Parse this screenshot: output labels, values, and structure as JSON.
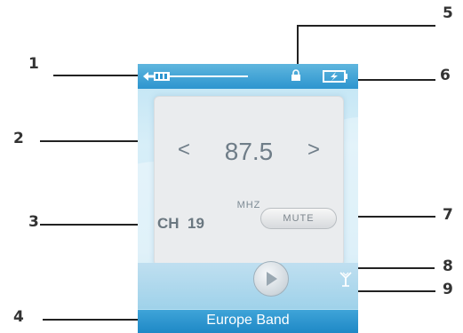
{
  "callouts": [
    "1",
    "2",
    "3",
    "4",
    "5",
    "6",
    "7",
    "8",
    "9"
  ],
  "tuner": {
    "prev_label": "<",
    "next_label": ">",
    "frequency": "87.5",
    "unit": "MHZ",
    "channel": "CH  19",
    "mute_label": "MUTE",
    "band": "Europe Band"
  },
  "icons": {
    "signal": "signal-strength-icon",
    "lock": "lock-icon",
    "battery": "battery-charging-icon",
    "play": "play-icon",
    "antenna": "antenna-icon"
  },
  "colors": {
    "accent": "#2d95cf",
    "screen_bg": "#cfeaf6",
    "text_gray": "#6f7d88"
  }
}
